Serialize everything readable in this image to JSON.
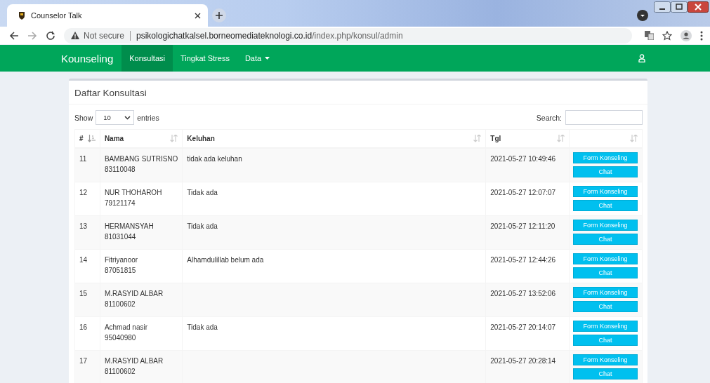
{
  "browser": {
    "tab_title": "Counselor Talk",
    "security": "Not secure",
    "url_host": "psikologichatkalsel.borneomediateknologi.co.id",
    "url_path": "/index.php/konsul/admin"
  },
  "navbar": {
    "brand": "Kounseling",
    "items": [
      {
        "label": "Konsultasi",
        "selected": true,
        "dropdown": false
      },
      {
        "label": "Tingkat Stress",
        "selected": false,
        "dropdown": false
      },
      {
        "label": "Data",
        "selected": false,
        "dropdown": true
      }
    ]
  },
  "box": {
    "title": "Daftar Konsultasi",
    "length": {
      "before": "Show",
      "value": "10",
      "after": "entries"
    },
    "search": {
      "label": "Search:"
    }
  },
  "table": {
    "columns": [
      {
        "label": "#",
        "sorted": true
      },
      {
        "label": "Nama",
        "sorted": false
      },
      {
        "label": "Keluhan",
        "sorted": false
      },
      {
        "label": "Tgl",
        "sorted": false
      },
      {
        "sorted": false
      }
    ],
    "rows": [
      {
        "no": "11",
        "name": "BAMBANG SUTRISNO",
        "id": "83110048",
        "keluhan": "tidak ada keluhan",
        "tgl": "2021-05-27 10:49:46",
        "buttons": [
          "Form Konseling",
          "Chat"
        ]
      },
      {
        "no": "12",
        "name": "NUR THOHAROH",
        "id": "79121174",
        "keluhan": "Tidak ada",
        "tgl": "2021-05-27 12:07:07",
        "buttons": [
          "Form Konseling",
          "Chat"
        ]
      },
      {
        "no": "13",
        "name": "HERMANSYAH",
        "id": "81031044",
        "keluhan": "Tidak ada",
        "tgl": "2021-05-27 12:11:20",
        "buttons": [
          "Form Konseling",
          "Chat"
        ]
      },
      {
        "no": "14",
        "name": "Fitriyanoor",
        "id": "87051815",
        "keluhan": "Alhamdulillab belum ada",
        "tgl": "2021-05-27 12:44:26",
        "buttons": [
          "Form Konseling",
          "Chat"
        ]
      },
      {
        "no": "15",
        "name": "M.RASYID ALBAR",
        "id": "81100602",
        "tgl": "2021-05-27 13:52:06",
        "buttons": [
          "Form Konseling",
          "Chat"
        ]
      },
      {
        "no": "16",
        "name": "Achmad nasir",
        "id": "95040980",
        "keluhan": "Tidak ada",
        "tgl": "2021-05-27 20:14:07",
        "buttons": [
          "Form Konseling",
          "Chat"
        ]
      },
      {
        "no": "17",
        "name": "M.RASYID ALBAR",
        "id": "81100602",
        "tgl": "2021-05-27 20:28:14",
        "buttons": [
          "Form Konseling",
          "Chat"
        ]
      }
    ]
  }
}
